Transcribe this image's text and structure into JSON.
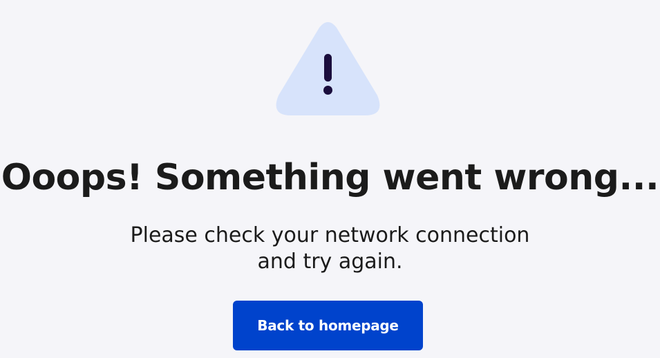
{
  "icon": {
    "name": "warning-triangle-icon",
    "fill_color": "#d7e3fb",
    "glyph_color": "#1b0e3d"
  },
  "error": {
    "title": "Ooops! Something went wrong...",
    "message_line1": "Please check your network connection",
    "message_line2": "and try again."
  },
  "actions": {
    "back_label": "Back to homepage"
  },
  "colors": {
    "background": "#f5f5f9",
    "text": "#1b1b1b",
    "button": "#0043cc",
    "button_text": "#ffffff"
  }
}
